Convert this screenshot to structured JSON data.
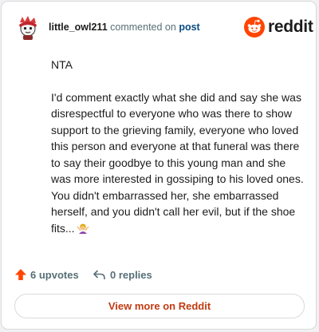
{
  "comment": {
    "username": "little_owl211",
    "action_text": "commented on",
    "post_link": "post",
    "paragraphs": [
      "NTA",
      "I'd comment exactly what she did and say she was disrespectful to everyone who was there to show support to the grieving family, everyone who loved this person and everyone at that funeral was there to say their goodbye to this young man and she was more interested in gossiping to his loved ones. You didn't embarrassed her, she embarrassed herself, and you didn't call her evil, but if the shoe fits..."
    ],
    "emoji": "woman-shrugging-emoji"
  },
  "brand": {
    "wordmark": "reddit",
    "logo_icon": "reddit-snoo-icon",
    "accent_color": "#ff4500"
  },
  "stats": {
    "upvotes_label": "6 upvotes",
    "replies_label": "0 replies",
    "upvote_icon": "upvote-arrow-icon",
    "reply_icon": "reply-arrow-icon",
    "upvote_color": "#ff4500"
  },
  "footer": {
    "view_more_label": "View more on Reddit",
    "link_color": "#c23b12"
  }
}
